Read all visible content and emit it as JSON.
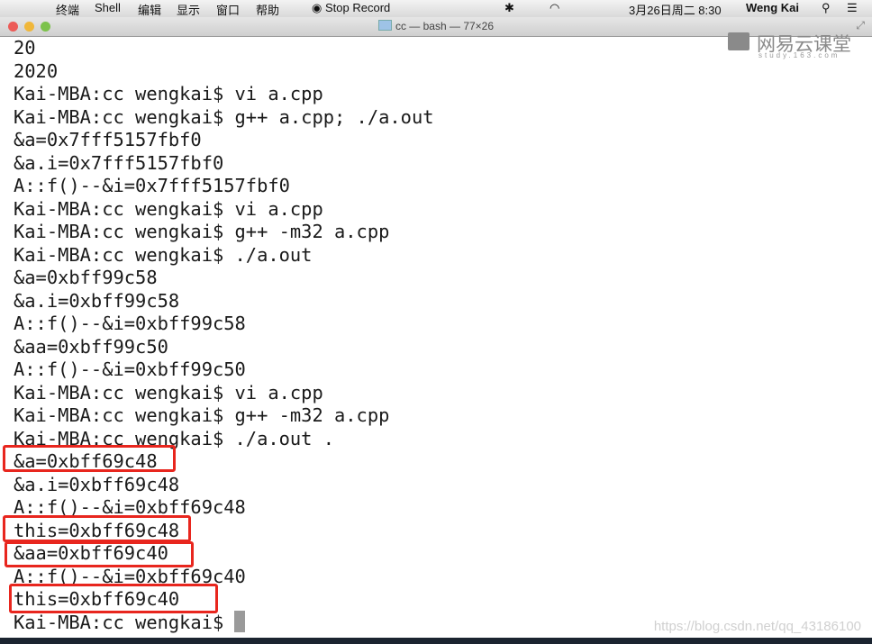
{
  "menubar": {
    "app": "终端",
    "items": [
      "Shell",
      "编辑",
      "显示",
      "窗口",
      "帮助"
    ],
    "record": "Stop Record",
    "datetime": "3月26日周二  8:30",
    "user": "Weng Kai"
  },
  "window": {
    "title": "cc — bash — 77×26"
  },
  "watermark": {
    "logo_text": "网易云课堂",
    "logo_sub": "study.163.com",
    "csdn": "https://blog.csdn.net/qq_43186100"
  },
  "terminal": {
    "lines": [
      "20",
      "2020",
      "Kai-MBA:cc wengkai$ vi a.cpp",
      "Kai-MBA:cc wengkai$ g++ a.cpp; ./a.out",
      "&a=0x7fff5157fbf0",
      "&a.i=0x7fff5157fbf0",
      "A::f()--&i=0x7fff5157fbf0",
      "Kai-MBA:cc wengkai$ vi a.cpp",
      "Kai-MBA:cc wengkai$ g++ -m32 a.cpp",
      "Kai-MBA:cc wengkai$ ./a.out",
      "&a=0xbff99c58",
      "&a.i=0xbff99c58",
      "A::f()--&i=0xbff99c58",
      "&aa=0xbff99c50",
      "A::f()--&i=0xbff99c50",
      "Kai-MBA:cc wengkai$ vi a.cpp",
      "Kai-MBA:cc wengkai$ g++ -m32 a.cpp",
      "Kai-MBA:cc wengkai$ ./a.out .",
      "&a=0xbff69c48",
      "&a.i=0xbff69c48",
      "A::f()--&i=0xbff69c48",
      "this=0xbff69c48",
      "&aa=0xbff69c40",
      "A::f()--&i=0xbff69c40",
      "this=0xbff69c40",
      "Kai-MBA:cc wengkai$ "
    ]
  },
  "highlight_color": "#e8261e"
}
